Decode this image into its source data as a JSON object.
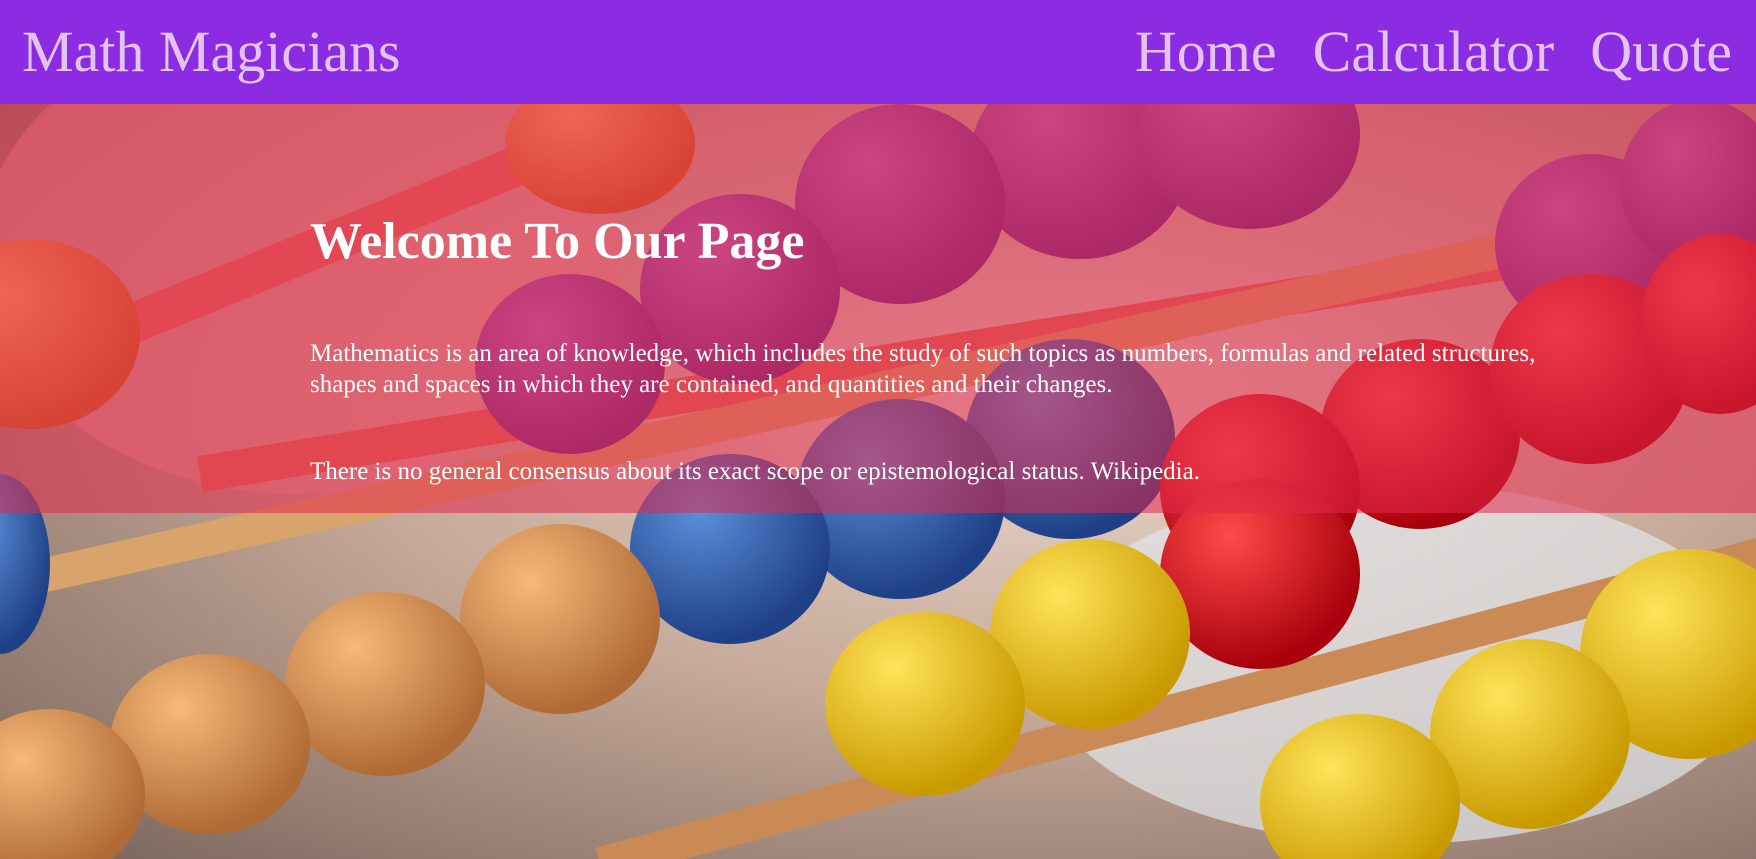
{
  "navbar": {
    "brand": "Math Magicians",
    "links": [
      "Home",
      "Calculator",
      "Quote"
    ]
  },
  "hero": {
    "title": "Welcome To Our Page",
    "paragraph_1": "Mathematics is an area of knowledge, which includes the study of such topics as numbers, formulas and related structures, shapes and spaces in which they are contained, and quantities and their changes.",
    "paragraph_2": "There is no general consensus about its exact scope or epistemological status. Wikipedia."
  },
  "colors": {
    "navbar_bg": "#8b2be2",
    "nav_text": "#e4c3f3",
    "hero_overlay": "#e2284a",
    "hero_text": "#ffffff"
  }
}
